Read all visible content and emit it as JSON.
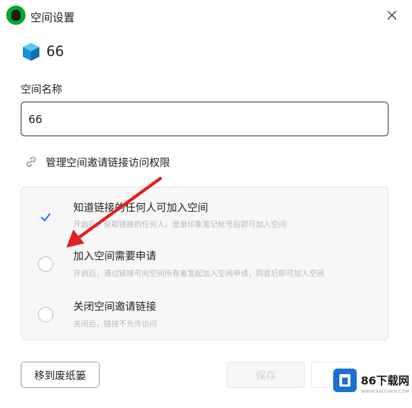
{
  "window": {
    "title": "空间设置"
  },
  "space": {
    "name_display": "66"
  },
  "form": {
    "name_label": "空间名称",
    "name_value": "66"
  },
  "manage_link": {
    "label": "管理空间邀请链接访问权限"
  },
  "options": [
    {
      "title": "知道链接的任何人可加入空间",
      "desc": "开启后，获取链接的任何人，登录印象笔记帐号后即可加入空间",
      "checked": true
    },
    {
      "title": "加入空间需要申请",
      "desc": "开启后，通过链接可向空间所有者发起加入空间申请，同意后即可加入空间",
      "checked": false
    },
    {
      "title": "关闭空间邀请链接",
      "desc": "关闭后，链接不允许访问",
      "checked": false
    }
  ],
  "buttons": {
    "trash": "移到废纸篓",
    "save": "保存"
  },
  "watermark": {
    "text": "86下载网",
    "sub": "WWW.86DOWN.COM"
  },
  "colors": {
    "accent": "#1a73e8",
    "app_green": "#00a82d",
    "arrow_red": "#e02020",
    "cube_blue": "#1aa3e8"
  },
  "icons": {
    "app": "evernote-elephant-icon",
    "close": "close-icon",
    "space": "cube-icon",
    "link": "link-icon",
    "check": "checkmark-icon"
  }
}
